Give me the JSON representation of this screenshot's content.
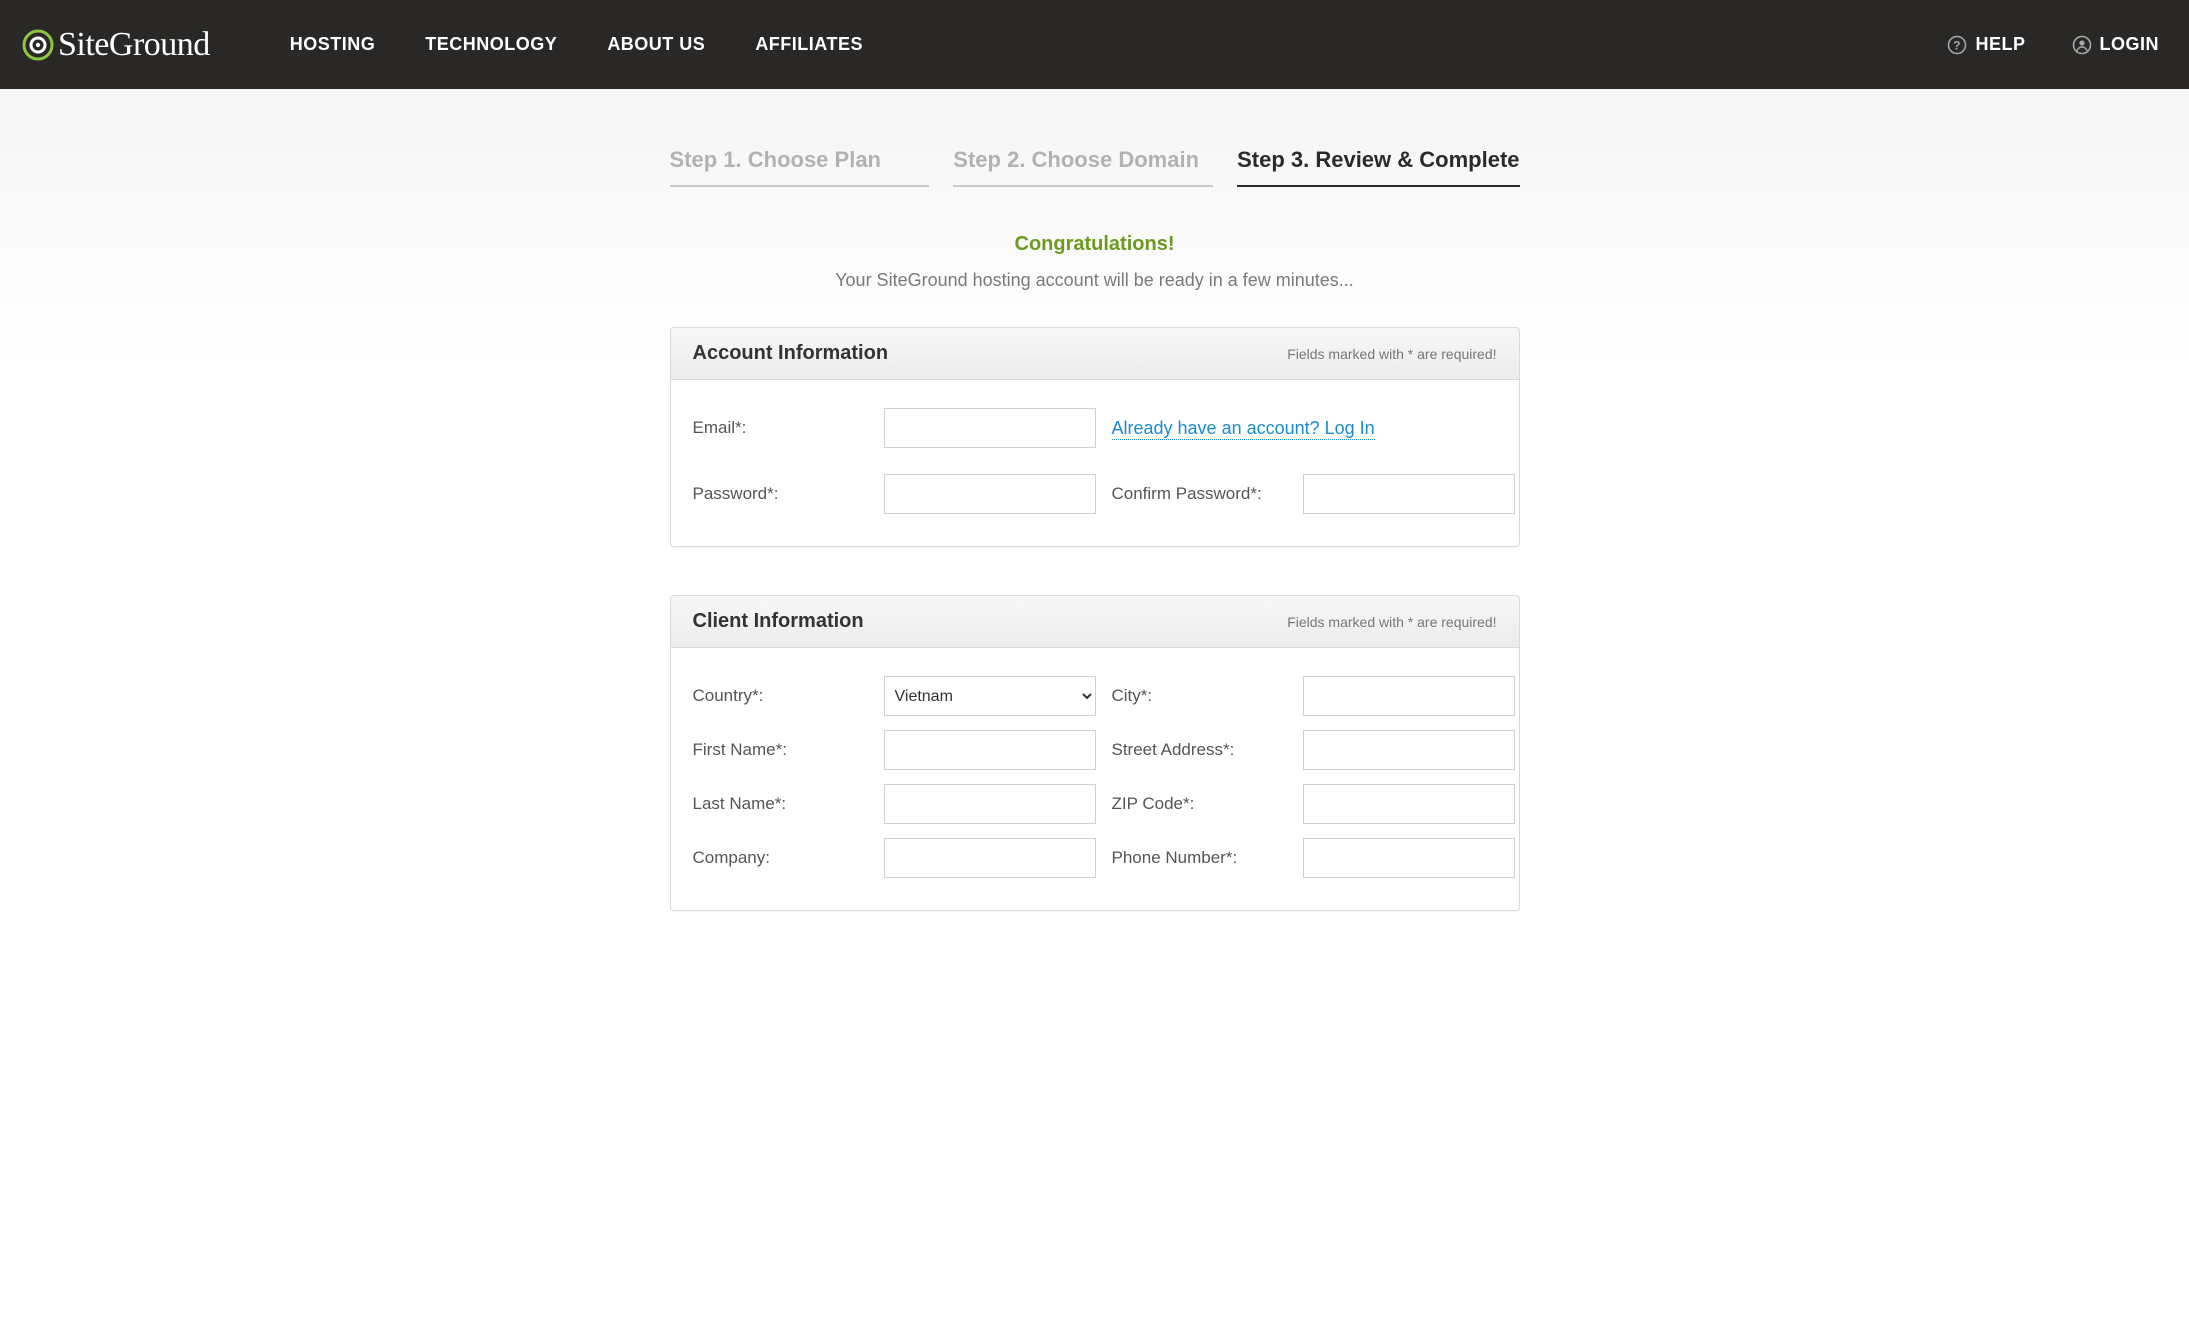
{
  "brand": {
    "name": "SiteGround"
  },
  "nav": {
    "items": [
      "HOSTING",
      "TECHNOLOGY",
      "ABOUT US",
      "AFFILIATES"
    ]
  },
  "topright": {
    "help": "HELP",
    "login": "LOGIN"
  },
  "steps": {
    "s1": "Step 1. Choose Plan",
    "s2": "Step 2. Choose Domain",
    "s3": "Step 3. Review & Complete"
  },
  "congrats": {
    "title": "Congratulations!",
    "sub": "Your SiteGround hosting account will be ready in a few minutes..."
  },
  "required_note": "Fields marked with * are required!",
  "account_panel": {
    "title": "Account Information",
    "email_label": "Email*:",
    "login_link": "Already have an account? Log In",
    "password_label": "Password*:",
    "confirm_label": "Confirm Password*:"
  },
  "client_panel": {
    "title": "Client Information",
    "country_label": "Country*:",
    "country_value": "Vietnam",
    "city_label": "City*:",
    "first_name_label": "First Name*:",
    "street_label": "Street Address*:",
    "last_name_label": "Last Name*:",
    "zip_label": "ZIP Code*:",
    "company_label": "Company:",
    "phone_label": "Phone Number*:"
  }
}
